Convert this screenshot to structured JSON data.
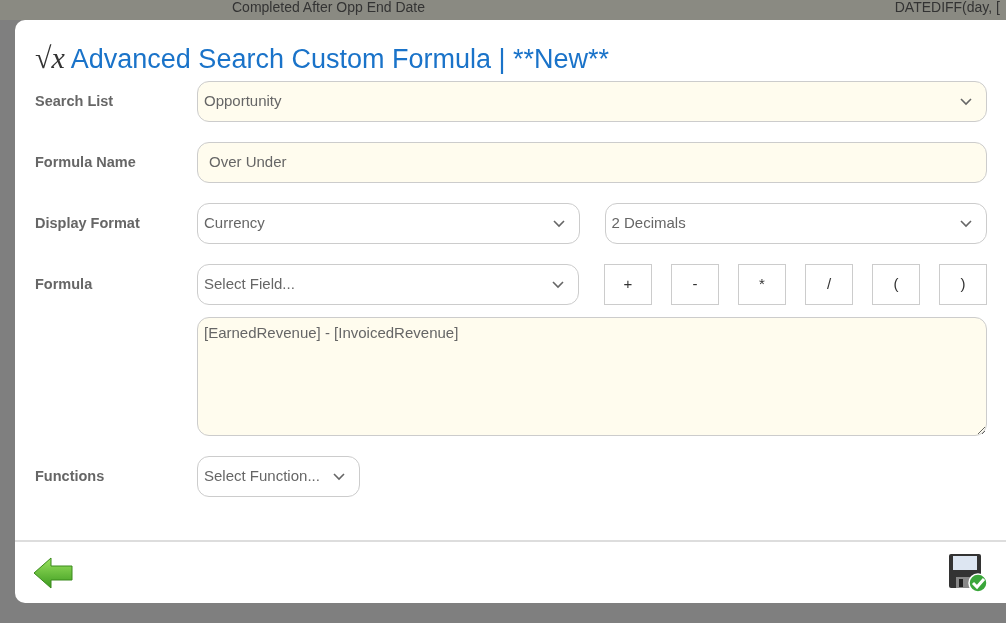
{
  "backdrop": {
    "column_1": "Completed After Opp End Date",
    "column_2": "DATEDIFF(day, ["
  },
  "dialog": {
    "title_symbol": "√x",
    "title": "Advanced Search Custom Formula | **New**"
  },
  "rows": [
    {
      "label": "Search List",
      "controls": [
        {
          "kind": "select",
          "value": "Opportunity",
          "filled": true
        }
      ]
    },
    {
      "label": "Formula Name",
      "controls": [
        {
          "kind": "input",
          "value": "Over Under",
          "filled": true
        }
      ]
    },
    {
      "label": "Display Format",
      "controls": [
        {
          "kind": "select",
          "value": "Currency",
          "filled": false
        },
        {
          "kind": "select",
          "value": "2 Decimals",
          "filled": false
        }
      ]
    },
    {
      "label": "Formula",
      "controls": [
        {
          "kind": "select",
          "placeholder": "Select Field...",
          "filled": false
        },
        {
          "kind": "operators",
          "items": [
            "+",
            "-",
            "*",
            "/",
            "(",
            ")"
          ]
        }
      ]
    },
    {
      "controls": [
        {
          "kind": "textarea",
          "value": "[EarnedRevenue] - [InvoicedRevenue]",
          "filled": true
        }
      ]
    },
    {
      "label": "Functions",
      "controls": [
        {
          "kind": "select",
          "placeholder": "Select Function...",
          "filled": false,
          "narrow": true
        }
      ]
    }
  ]
}
